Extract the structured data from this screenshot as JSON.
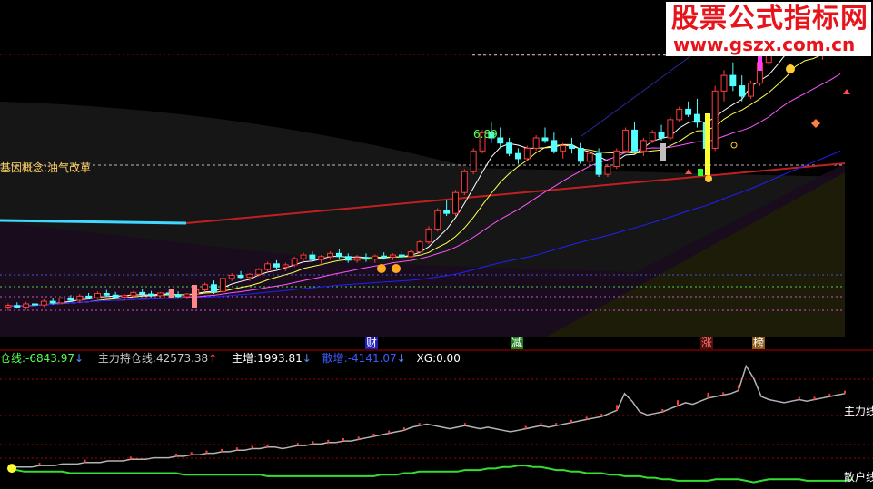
{
  "watermark": {
    "title": "股票公式指标网",
    "url": "www.gszx.com.cn"
  },
  "upper_panel": {
    "concept_label": "基因概念;油气改革",
    "peak_label": "6.89",
    "event_markers": [
      "财",
      "减",
      "涨",
      "榜"
    ]
  },
  "indicator_header": {
    "item1_name": "仓线:",
    "item1_value": "-6843.97",
    "item1_arrow": "↓",
    "item2_name": "主力持仓线:",
    "item2_value": "42573.38",
    "item2_arrow": "↑",
    "item3_name": "主增:",
    "item3_value": "1993.81",
    "item3_arrow": "↓",
    "item4_name": "散增:",
    "item4_value": "-4141.07",
    "item4_arrow": "↓",
    "item5_name": "XG:",
    "item5_value": "0.00"
  },
  "lower_panel": {
    "main_line_label": "主力线",
    "retail_line_label": "散户线"
  },
  "colors": {
    "up": "#ff3c3c",
    "down": "#54ffff",
    "grid": "#b00000",
    "ma5": "#ffffff",
    "ma10": "#ffff55",
    "ma20": "#ff55ff",
    "ma60": "#2020ff",
    "main_line": "#b4b4b4",
    "retail_line": "#33dd33"
  },
  "chart_data": [
    {
      "type": "candlestick",
      "title": "",
      "ylim": [
        1.5,
        7.6
      ],
      "reference_levels": [
        6.89
      ],
      "series_colors": {
        "up": "#ff3c3c",
        "down": "#54ffff"
      },
      "candles": [
        [
          2.05,
          2.12,
          1.98,
          2.08
        ],
        [
          2.08,
          2.14,
          2.02,
          2.05
        ],
        [
          2.05,
          2.15,
          2.0,
          2.11
        ],
        [
          2.11,
          2.18,
          2.06,
          2.09
        ],
        [
          2.09,
          2.2,
          2.05,
          2.16
        ],
        [
          2.16,
          2.22,
          2.1,
          2.13
        ],
        [
          2.13,
          2.25,
          2.1,
          2.22
        ],
        [
          2.22,
          2.28,
          2.15,
          2.18
        ],
        [
          2.18,
          2.3,
          2.14,
          2.26
        ],
        [
          2.26,
          2.32,
          2.2,
          2.23
        ],
        [
          2.23,
          2.35,
          2.2,
          2.31
        ],
        [
          2.31,
          2.38,
          2.25,
          2.28
        ],
        [
          2.28,
          2.34,
          2.2,
          2.24
        ],
        [
          2.24,
          2.3,
          2.18,
          2.27
        ],
        [
          2.27,
          2.36,
          2.22,
          2.33
        ],
        [
          2.33,
          2.4,
          2.26,
          2.3
        ],
        [
          2.3,
          2.36,
          2.24,
          2.27
        ],
        [
          2.27,
          2.34,
          2.22,
          2.32
        ],
        [
          2.32,
          2.38,
          2.26,
          2.29
        ],
        [
          2.29,
          2.35,
          2.22,
          2.25
        ],
        [
          2.25,
          2.32,
          2.2,
          2.3
        ],
        [
          2.3,
          2.42,
          2.26,
          2.38
        ],
        [
          2.38,
          2.52,
          2.34,
          2.48
        ],
        [
          2.48,
          2.56,
          2.3,
          2.35
        ],
        [
          2.35,
          2.62,
          2.32,
          2.6
        ],
        [
          2.6,
          2.7,
          2.55,
          2.66
        ],
        [
          2.66,
          2.74,
          2.58,
          2.62
        ],
        [
          2.62,
          2.7,
          2.55,
          2.68
        ],
        [
          2.68,
          2.8,
          2.64,
          2.77
        ],
        [
          2.77,
          2.92,
          2.72,
          2.88
        ],
        [
          2.88,
          2.95,
          2.78,
          2.82
        ],
        [
          2.82,
          2.9,
          2.74,
          2.86
        ],
        [
          2.86,
          3.02,
          2.82,
          2.98
        ],
        [
          2.98,
          3.1,
          2.9,
          3.05
        ],
        [
          3.05,
          3.12,
          2.92,
          2.96
        ],
        [
          2.96,
          3.05,
          2.88,
          3.02
        ],
        [
          3.02,
          3.12,
          2.96,
          3.08
        ],
        [
          3.08,
          3.16,
          2.98,
          3.02
        ],
        [
          3.02,
          3.08,
          2.9,
          2.95
        ],
        [
          2.95,
          3.05,
          2.9,
          3.0
        ],
        [
          3.0,
          3.08,
          2.92,
          2.97
        ],
        [
          2.97,
          3.06,
          2.9,
          3.03
        ],
        [
          3.03,
          3.1,
          2.96,
          3.01
        ],
        [
          3.01,
          3.08,
          2.95,
          3.05
        ],
        [
          3.05,
          3.12,
          2.98,
          3.02
        ],
        [
          3.02,
          3.14,
          3.0,
          3.11
        ],
        [
          3.11,
          3.35,
          3.08,
          3.3
        ],
        [
          3.3,
          3.6,
          3.26,
          3.55
        ],
        [
          3.55,
          3.95,
          3.5,
          3.9
        ],
        [
          3.9,
          4.1,
          3.8,
          3.85
        ],
        [
          3.85,
          4.3,
          3.8,
          4.25
        ],
        [
          4.25,
          4.7,
          4.2,
          4.65
        ],
        [
          4.65,
          5.1,
          4.6,
          5.05
        ],
        [
          5.05,
          5.45,
          5.0,
          5.4
        ],
        [
          5.4,
          5.6,
          5.2,
          5.3
        ],
        [
          5.3,
          5.5,
          5.1,
          5.2
        ],
        [
          5.2,
          5.3,
          4.95,
          5.0
        ],
        [
          5.0,
          5.1,
          4.8,
          4.9
        ],
        [
          4.9,
          5.15,
          4.85,
          5.1
        ],
        [
          5.1,
          5.35,
          5.05,
          5.3
        ],
        [
          5.3,
          5.5,
          5.2,
          5.25
        ],
        [
          5.25,
          5.4,
          5.0,
          5.05
        ],
        [
          5.05,
          5.2,
          4.9,
          5.15
        ],
        [
          5.15,
          5.3,
          5.0,
          5.1
        ],
        [
          5.1,
          5.2,
          4.8,
          4.85
        ],
        [
          4.85,
          5.05,
          4.75,
          5.0
        ],
        [
          5.0,
          5.1,
          4.55,
          4.6
        ],
        [
          4.6,
          4.8,
          4.55,
          4.75
        ],
        [
          4.75,
          5.1,
          4.7,
          5.05
        ],
        [
          5.05,
          5.5,
          5.0,
          5.45
        ],
        [
          5.45,
          5.6,
          5.0,
          5.05
        ],
        [
          5.05,
          5.3,
          4.95,
          5.25
        ],
        [
          5.25,
          5.45,
          5.2,
          5.4
        ],
        [
          5.4,
          5.55,
          5.25,
          5.3
        ],
        [
          5.3,
          5.7,
          5.25,
          5.65
        ],
        [
          5.65,
          5.9,
          5.6,
          5.85
        ],
        [
          5.85,
          6.0,
          5.7,
          5.75
        ],
        [
          5.75,
          6.05,
          5.5,
          5.6
        ],
        [
          5.6,
          5.7,
          5.05,
          5.1
        ],
        [
          5.1,
          6.3,
          5.05,
          6.2
        ],
        [
          6.2,
          6.6,
          6.0,
          6.5
        ],
        [
          6.5,
          6.75,
          6.2,
          6.3
        ],
        [
          6.3,
          6.5,
          6.0,
          6.1
        ],
        [
          6.1,
          6.4,
          6.05,
          6.35
        ],
        [
          6.35,
          6.8,
          6.3,
          6.75
        ],
        [
          6.75,
          7.1,
          6.7,
          7.05
        ],
        [
          7.05,
          7.4,
          6.95,
          7.3
        ],
        [
          7.3,
          7.55,
          7.1,
          7.2
        ],
        [
          7.2,
          7.35,
          6.95,
          7.0
        ],
        [
          7.0,
          7.3,
          6.9,
          7.25
        ],
        [
          7.25,
          7.35,
          6.9,
          6.95
        ],
        [
          6.95,
          7.15,
          6.8,
          7.1
        ],
        [
          7.1,
          7.3,
          7.0,
          7.2
        ],
        [
          7.2,
          7.45,
          7.1,
          7.4
        ]
      ]
    },
    {
      "type": "line",
      "title": "",
      "series": [
        {
          "name": "主力线",
          "values": [
            12,
            12,
            12,
            12,
            13,
            13,
            13,
            14,
            14,
            14,
            15,
            15,
            15,
            16,
            16,
            16,
            17,
            17,
            17,
            18,
            18,
            18,
            19,
            19,
            20,
            20,
            21,
            21,
            22,
            22,
            23,
            23,
            24,
            24,
            25,
            25,
            24,
            25,
            26,
            26,
            27,
            27,
            28,
            28,
            29,
            29,
            30,
            31,
            32,
            33,
            34,
            35,
            36,
            38,
            39,
            40,
            39,
            38,
            37,
            38,
            39,
            38,
            37,
            38,
            37,
            36,
            35,
            36,
            37,
            38,
            39,
            38,
            39,
            40,
            41,
            42,
            43,
            44,
            45,
            47,
            49,
            60,
            55,
            48,
            46,
            47,
            48,
            50,
            52,
            54,
            53,
            55,
            57,
            58,
            59,
            60,
            62,
            78,
            70,
            58,
            56,
            55,
            54,
            55,
            56,
            55,
            56,
            57,
            58,
            59,
            60
          ]
        },
        {
          "name": "散户线",
          "values": [
            10,
            10,
            9,
            9,
            9,
            9,
            9,
            9,
            8,
            8,
            8,
            8,
            8,
            8,
            8,
            8,
            8,
            8,
            8,
            8,
            8,
            8,
            8,
            7,
            7,
            7,
            7,
            7,
            7,
            7,
            7,
            7,
            7,
            7,
            6,
            6,
            6,
            6,
            6,
            6,
            6,
            6,
            6,
            6,
            6,
            6,
            6,
            6,
            6,
            7,
            7,
            7,
            8,
            8,
            9,
            9,
            9,
            9,
            9,
            9,
            10,
            10,
            10,
            11,
            11,
            12,
            12,
            13,
            13,
            12,
            12,
            11,
            10,
            10,
            9,
            9,
            8,
            8,
            8,
            7,
            7,
            6,
            6,
            6,
            5,
            5,
            4,
            4,
            3,
            3,
            3,
            3,
            3,
            4,
            4,
            4,
            4,
            3,
            2,
            3,
            4,
            4,
            4,
            4,
            4,
            3,
            3,
            3,
            3,
            3,
            3,
            4
          ]
        }
      ]
    }
  ]
}
